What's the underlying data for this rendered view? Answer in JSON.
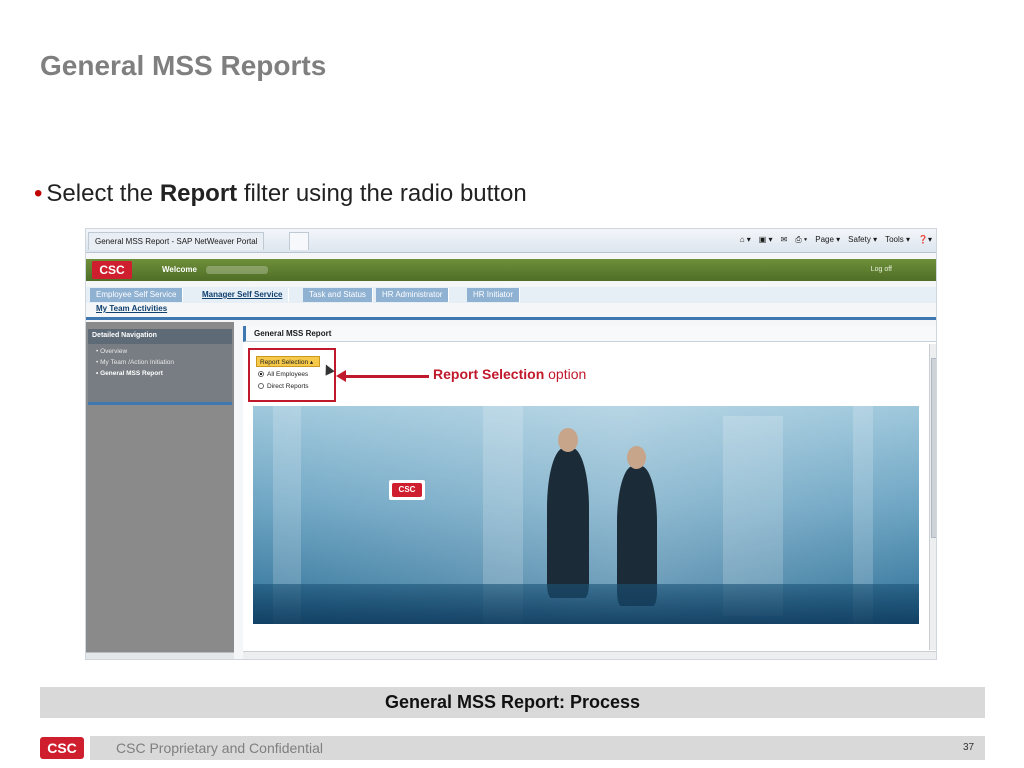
{
  "slide": {
    "title": "General MSS Reports",
    "bullet_prefix": "Select the ",
    "bullet_bold": "Report",
    "bullet_suffix": " filter using the radio button",
    "caption": "General MSS Report: Process",
    "confidential": "CSC Proprietary and Confidential",
    "page_number": "37",
    "logo_text": "CSC",
    "accent_color": "#c0192c"
  },
  "browser": {
    "tab_title": "General MSS Report - SAP NetWeaver Portal",
    "tools": [
      "Page ▾",
      "Safety ▾",
      "Tools ▾"
    ]
  },
  "portal": {
    "logo_text": "CSC",
    "welcome_label": "Welcome",
    "logoff_label": "Log off",
    "tabs": [
      {
        "label": "Employee Self Service",
        "active": false
      },
      {
        "label": "Manager Self Service",
        "active": true
      },
      {
        "label": "Task and Status",
        "active": false
      },
      {
        "label": "HR Administrator",
        "active": false
      },
      {
        "label": "HR Initiator",
        "active": false
      }
    ],
    "subtab": "My Team Activities",
    "nav": {
      "heading": "Detailed Navigation",
      "items": [
        "Overview",
        "My Team /Action Initiation",
        "General MSS Report"
      ]
    },
    "content": {
      "heading": "General MSS Report",
      "filter_button": "Report Selection",
      "radio_all": "All Employees",
      "radio_direct": "Direct Reports",
      "callout_bold": "Report Selection",
      "callout_rest": " option",
      "banner_logo": "CSC"
    }
  }
}
